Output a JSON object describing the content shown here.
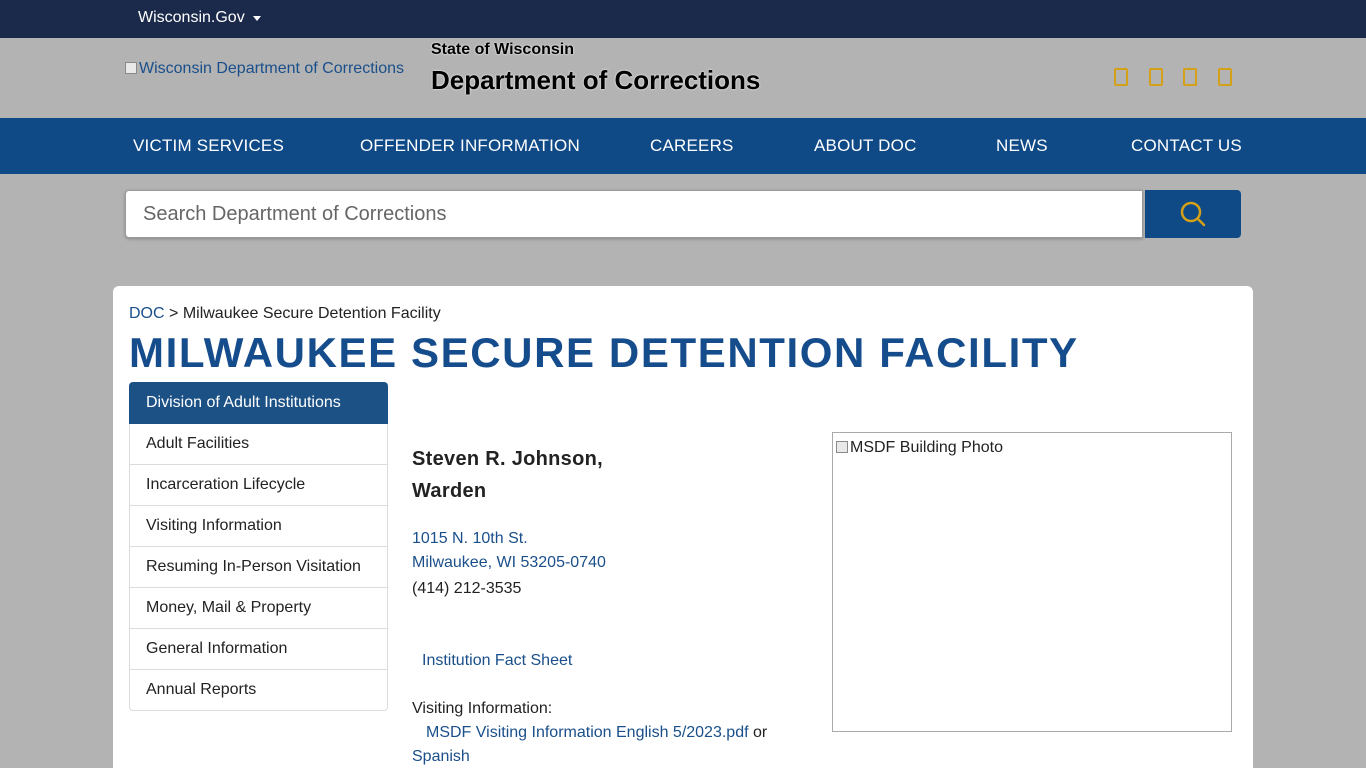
{
  "topbar": {
    "site_link": "Wisconsin.Gov"
  },
  "header": {
    "logo_alt": "Wisconsin Department of Corrections",
    "state": "State of Wisconsin",
    "department": "Department of Corrections",
    "social_icons": [
      "facebook-icon",
      "twitter-icon",
      "instagram-icon",
      "youtube-icon"
    ],
    "accent_color": "#d4a017"
  },
  "nav": {
    "items": [
      "VICTIM SERVICES",
      "OFFENDER INFORMATION",
      "CAREERS",
      "ABOUT DOC",
      "NEWS",
      "CONTACT US"
    ]
  },
  "search": {
    "placeholder": "Search Department of Corrections",
    "button_icon": "search-icon"
  },
  "breadcrumb": {
    "root": "DOC",
    "separator": ">",
    "current": "Milwaukee Secure Detention Facility"
  },
  "page_title": "MILWAUKEE SECURE DETENTION FACILITY",
  "sidebar": {
    "heading": "Division of Adult Institutions",
    "items": [
      "Adult Facilities",
      "Incarceration Lifecycle",
      "Visiting Information",
      "Resuming In-Person Visitation",
      "Money, Mail & Property",
      "General Information",
      "Annual Reports"
    ]
  },
  "facility": {
    "warden_name": "Steven R. Johnson,",
    "warden_title": "Warden",
    "address_line1": "1015 N. 10th St.",
    "address_line2": "Milwaukee, WI 53205-0740",
    "phone": "(414) 212-3535",
    "fact_sheet": "Institution Fact Sheet",
    "visiting_label": "Visiting Information:",
    "visiting_link": "MSDF Visiting Information English 5/2023.pdf",
    "or_text": " or",
    "spanish_link": "Spanish",
    "photo_alt": "MSDF Building Photo"
  },
  "colors": {
    "topbar": "#1b2a4a",
    "nav": "#0f4a87",
    "title": "#154c8c",
    "link": "#1a4f8b",
    "background": "#b3b3b3"
  }
}
